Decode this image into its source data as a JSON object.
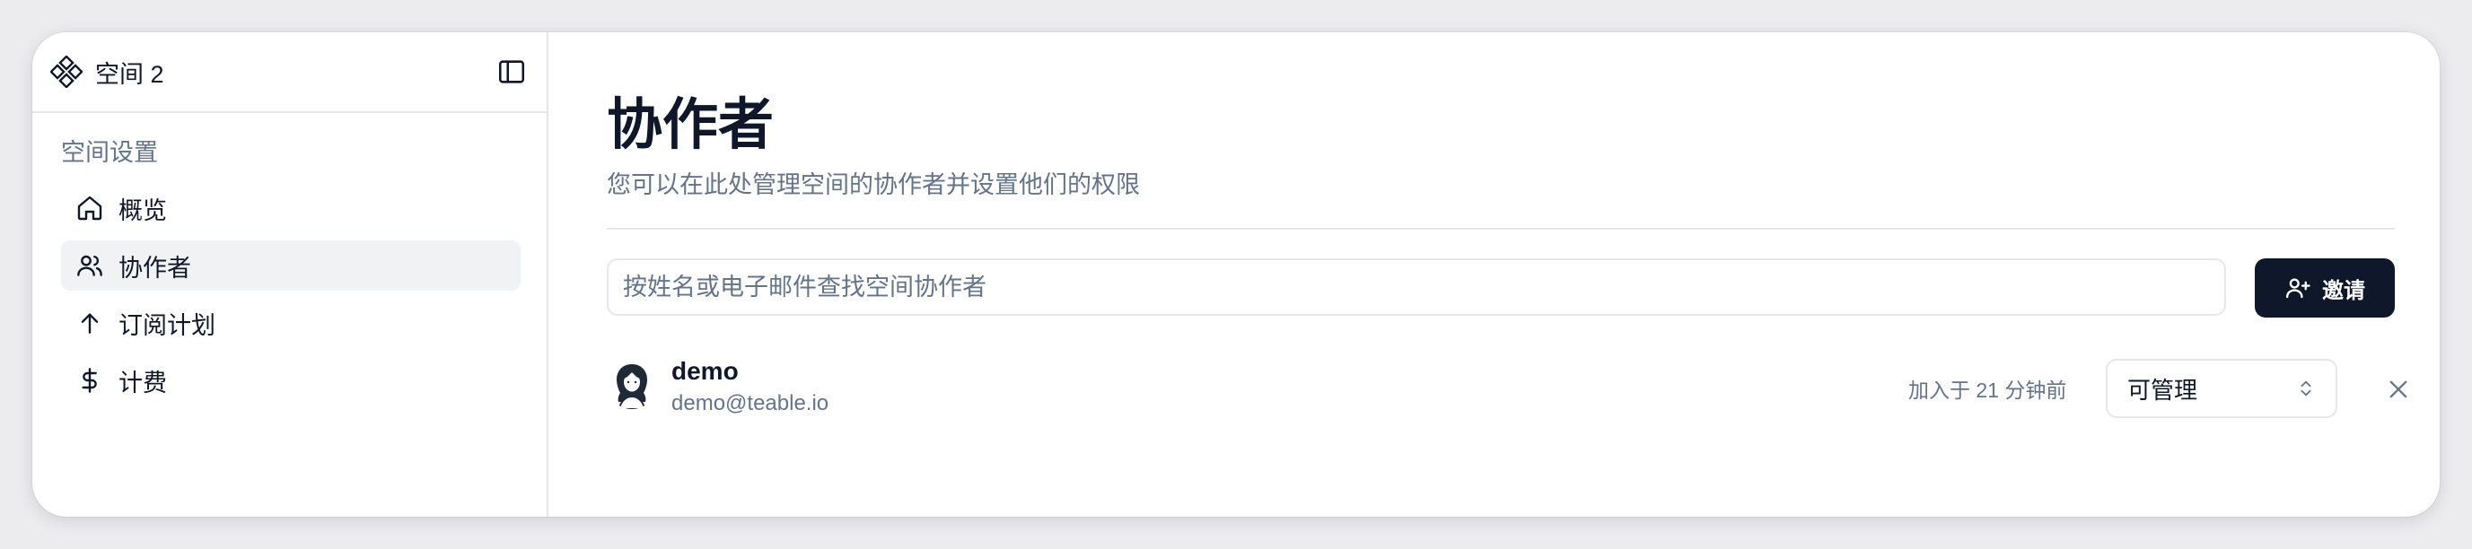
{
  "sidebar": {
    "space_name": "空间 2",
    "section_title": "空间设置",
    "items": [
      {
        "label": "概览",
        "icon": "home-icon"
      },
      {
        "label": "协作者",
        "icon": "users-icon",
        "active": true
      },
      {
        "label": "订阅计划",
        "icon": "arrow-up-icon"
      },
      {
        "label": "计费",
        "icon": "dollar-icon"
      }
    ]
  },
  "main": {
    "title": "协作者",
    "subtitle": "您可以在此处管理空间的协作者并设置他们的权限",
    "search": {
      "placeholder": "按姓名或电子邮件查找空间协作者",
      "value": ""
    },
    "invite_label": "邀请",
    "members": [
      {
        "name": "demo",
        "email": "demo@teable.io",
        "joined": "加入于 21 分钟前",
        "role": "可管理"
      }
    ]
  },
  "colors": {
    "primary": "#0f172a",
    "muted": "#64748b",
    "border": "#e5e7eb",
    "active_bg": "#f1f2f4"
  }
}
